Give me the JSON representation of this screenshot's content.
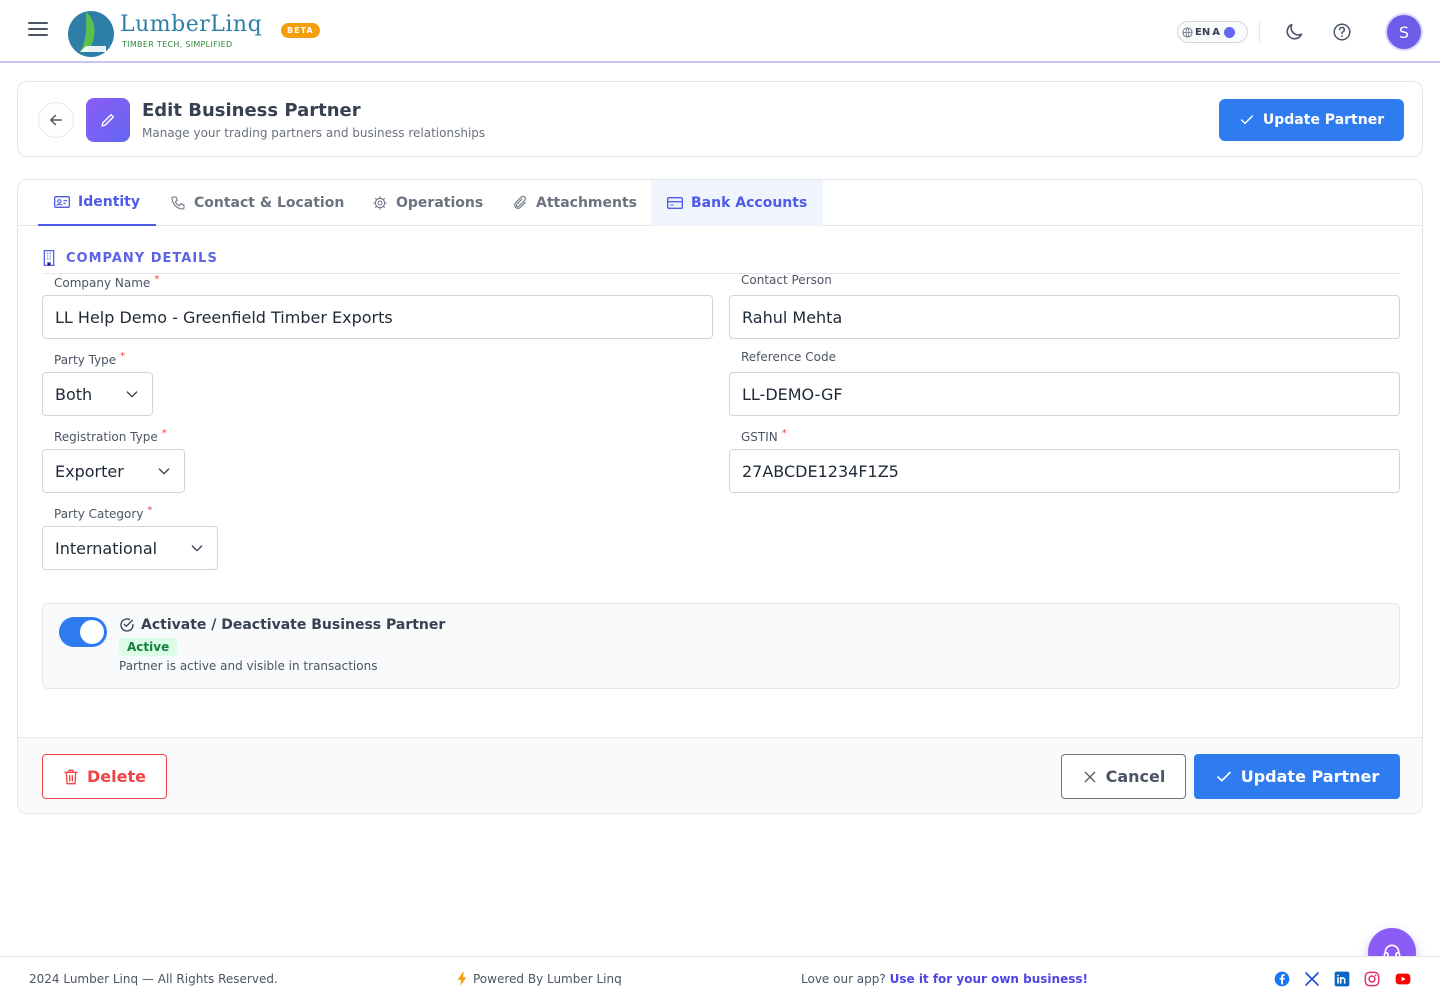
{
  "brand": {
    "name": "LumberLinq",
    "tagline": "TIMBER TECH, SIMPLIFIED",
    "badge": "BETA"
  },
  "topbar": {
    "language": "EN",
    "language_alt": "A",
    "avatar_initial": "S"
  },
  "header": {
    "title": "Edit Business Partner",
    "subtitle": "Manage your trading partners and business relationships",
    "update_label": "Update Partner"
  },
  "tabs": [
    {
      "label": "Identity",
      "icon": "id-card-icon",
      "active": true
    },
    {
      "label": "Contact & Location",
      "icon": "phone-icon"
    },
    {
      "label": "Operations",
      "icon": "gear-icon"
    },
    {
      "label": "Attachments",
      "icon": "paperclip-icon"
    },
    {
      "label": "Bank Accounts",
      "icon": "credit-card-icon",
      "highlighted": true
    }
  ],
  "section": {
    "title": "COMPANY DETAILS"
  },
  "form": {
    "company_name": {
      "label": "Company Name",
      "value": "LL Help Demo - Greenfield Timber Exports",
      "required": "*"
    },
    "contact_person": {
      "label": "Contact Person",
      "value": "Rahul Mehta"
    },
    "party_type": {
      "label": "Party Type",
      "value": "Both",
      "required": "*"
    },
    "reference_code": {
      "label": "Reference Code",
      "value": "LL-DEMO-GF"
    },
    "registration_type": {
      "label": "Registration Type",
      "value": "Exporter",
      "required": "*"
    },
    "gstin": {
      "label": "GSTIN",
      "value": "27ABCDE1234F1Z5",
      "required": "*"
    },
    "party_category": {
      "label": "Party Category",
      "value": "International",
      "required": "*"
    }
  },
  "status": {
    "title": "Activate / Deactivate Business Partner",
    "badge": "Active",
    "description": "Partner is active and visible in transactions",
    "enabled": true
  },
  "actions": {
    "delete_label": "Delete",
    "cancel_label": "Cancel",
    "update_label": "Update Partner"
  },
  "footer": {
    "copyright": "2024 Lumber Linq — All Rights Reserved.",
    "powered": "Powered By Lumber Linq",
    "love_prefix": "Love our app?",
    "love_link": "Use it for your own business!"
  },
  "colors": {
    "primary": "#2f7bf0",
    "accent": "#4f5be8",
    "danger": "#ef4444",
    "success": "#15803d"
  }
}
